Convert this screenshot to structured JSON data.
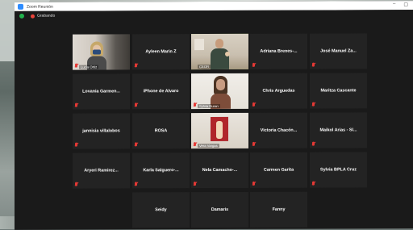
{
  "window": {
    "title": "Zoom Reunión",
    "controls": [
      "–",
      "▢"
    ]
  },
  "toolbar": {
    "recording_label": "Grabando"
  },
  "colors": {
    "tile_bg": "#232323",
    "active_speaker": "#a6d24d",
    "muted": "#e53935",
    "recording": "#e8433a"
  },
  "participants": [
    {
      "name": "Lucía Ortiz",
      "video": true,
      "muted": true
    },
    {
      "name": "Ayleen Marin Z",
      "video": false,
      "muted": true
    },
    {
      "name": "CEOR",
      "video": true,
      "muted": false,
      "active": true
    },
    {
      "name": "Adriana Brenes-...",
      "video": false,
      "muted": true
    },
    {
      "name": "José Manuel Za...",
      "video": false,
      "muted": true
    },
    {
      "name": "Lovania Garmen...",
      "video": false,
      "muted": true
    },
    {
      "name": "iPhone de Alvaro",
      "video": false,
      "muted": true
    },
    {
      "name": "Sylvia Duran",
      "video": true,
      "muted": true
    },
    {
      "name": "Chris Arguedas",
      "video": false,
      "muted": true
    },
    {
      "name": "Maritza Cascante",
      "video": false,
      "muted": true
    },
    {
      "name": "jannisia villalobos",
      "video": false,
      "muted": true
    },
    {
      "name": "ROSA",
      "video": false,
      "muted": true
    },
    {
      "name": "Vera Vargas",
      "video": true,
      "muted": true
    },
    {
      "name": "Victoria Chacón...",
      "video": false,
      "muted": true
    },
    {
      "name": "Maikol Arias - Sl...",
      "video": false,
      "muted": true
    },
    {
      "name": "Aryeri Ramirez...",
      "video": false,
      "muted": true
    },
    {
      "name": "Karla Salguero-...",
      "video": false,
      "muted": true
    },
    {
      "name": "Nela Camacho-...",
      "video": false,
      "muted": true
    },
    {
      "name": "Carmen Garita",
      "video": false,
      "muted": true
    },
    {
      "name": "Sylvia BPLA Cruz",
      "video": false,
      "muted": true
    },
    {
      "name": "Seidy",
      "video": false,
      "muted": false
    },
    {
      "name": "Damaris",
      "video": false,
      "muted": false
    },
    {
      "name": "Fanny",
      "video": false,
      "muted": false
    }
  ]
}
